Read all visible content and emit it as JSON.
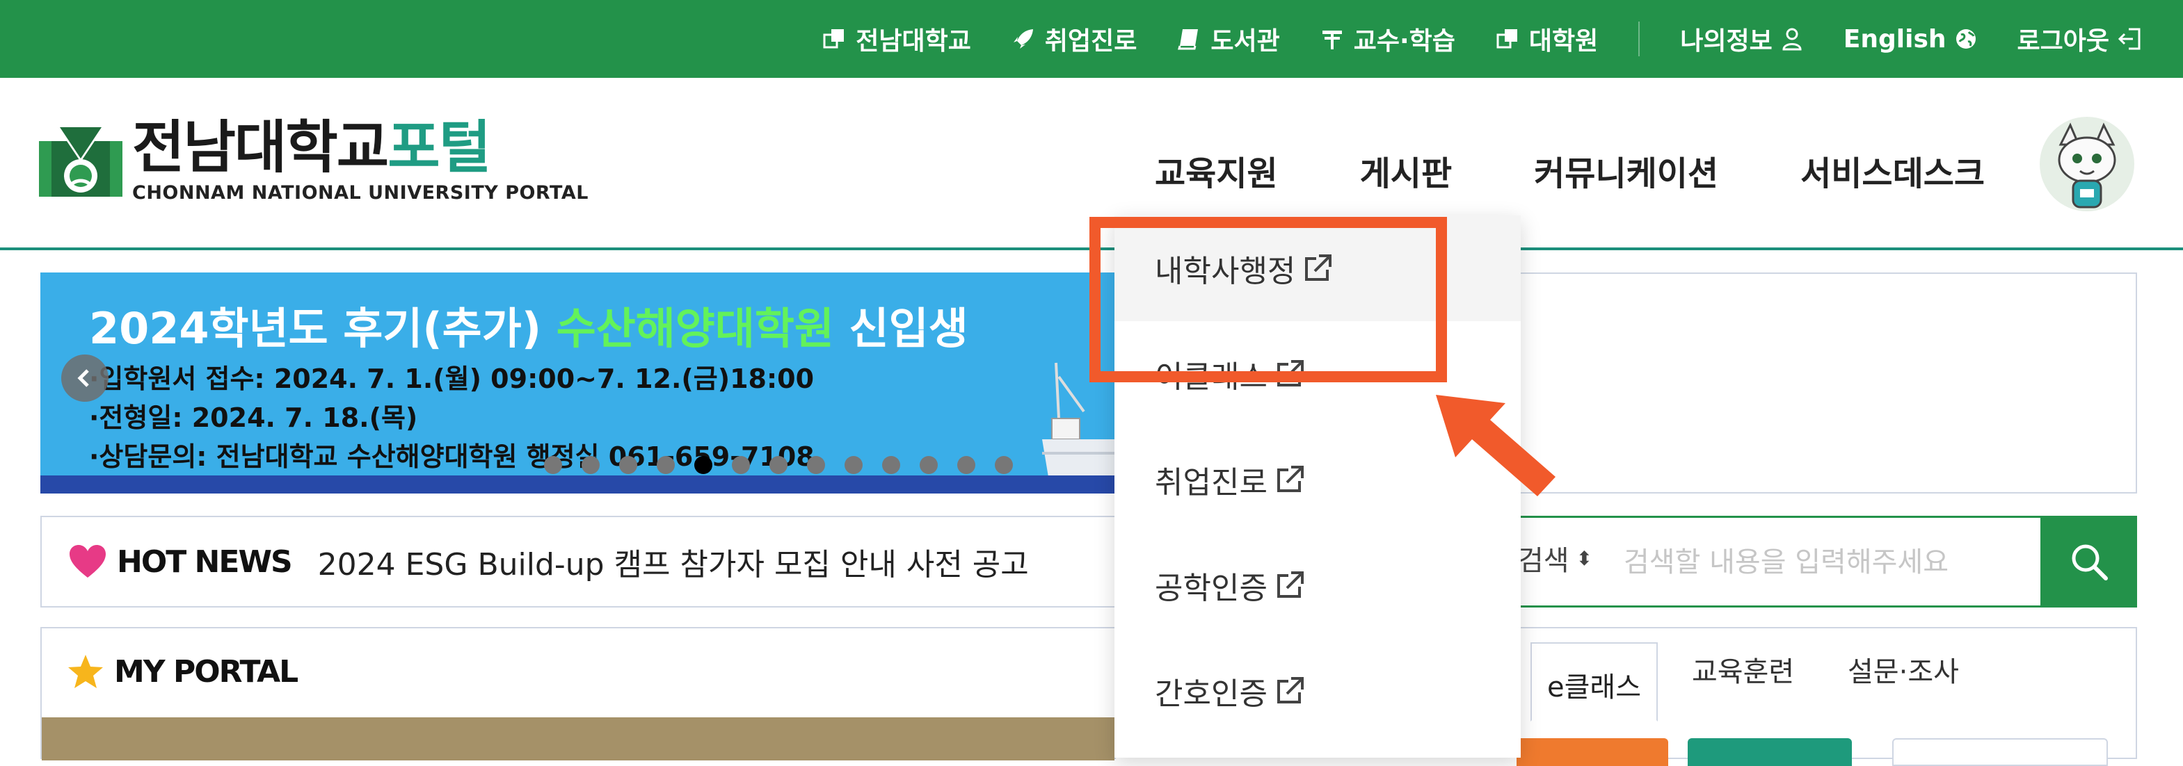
{
  "topbar": {
    "links": [
      {
        "label": "전남대학교",
        "icon": "window-link-icon"
      },
      {
        "label": "취업진로",
        "icon": "rocket-icon"
      },
      {
        "label": "도서관",
        "icon": "book-icon"
      },
      {
        "label": "교수·학습",
        "icon": "lectern-icon"
      },
      {
        "label": "대학원",
        "icon": "window-link-icon"
      }
    ],
    "my_info": "나의정보",
    "language": "English",
    "logout": "로그아웃",
    "bg_color": "#23924a"
  },
  "header": {
    "logo_main": "전남대학교",
    "logo_accent": "포털",
    "logo_sub": "CHONNAM NATIONAL UNIVERSITY PORTAL",
    "nav": [
      "교육지원",
      "게시판",
      "커뮤니케이션",
      "서비스데스크"
    ],
    "accent_color": "#1c8f7c"
  },
  "banner": {
    "headline_white": "2024학년도 후기(추가) ",
    "headline_green": "수산해양대학원",
    "headline_tail": " 신입생",
    "line1": "·입학원서 접수: 2024. 7. 1.(월) 09:00~7. 12.(금)18:00",
    "line2": "·전형일: 2024. 7. 18.(목)",
    "line3": "·상담문의: 전남대학교 수산해양대학원 행정실 061-659-7108",
    "dot_count": 13,
    "active_dot": 4
  },
  "hotnews": {
    "label": "HOT NEWS",
    "text": "2024 ESG Build-up 캠프 참가자 모집 안내 사전 공고"
  },
  "search": {
    "select_label": "검색",
    "placeholder": "검색할 내용을 입력해주세요"
  },
  "myportal": {
    "label": "MY PORTAL"
  },
  "right_tabs": [
    "e클래스",
    "교육훈련",
    "설문·조사"
  ],
  "dropdown": {
    "items": [
      "내학사행정",
      "이클래스",
      "취업진로",
      "공학인증",
      "간호인증"
    ]
  },
  "annotation": {
    "color": "#f15a2b"
  }
}
